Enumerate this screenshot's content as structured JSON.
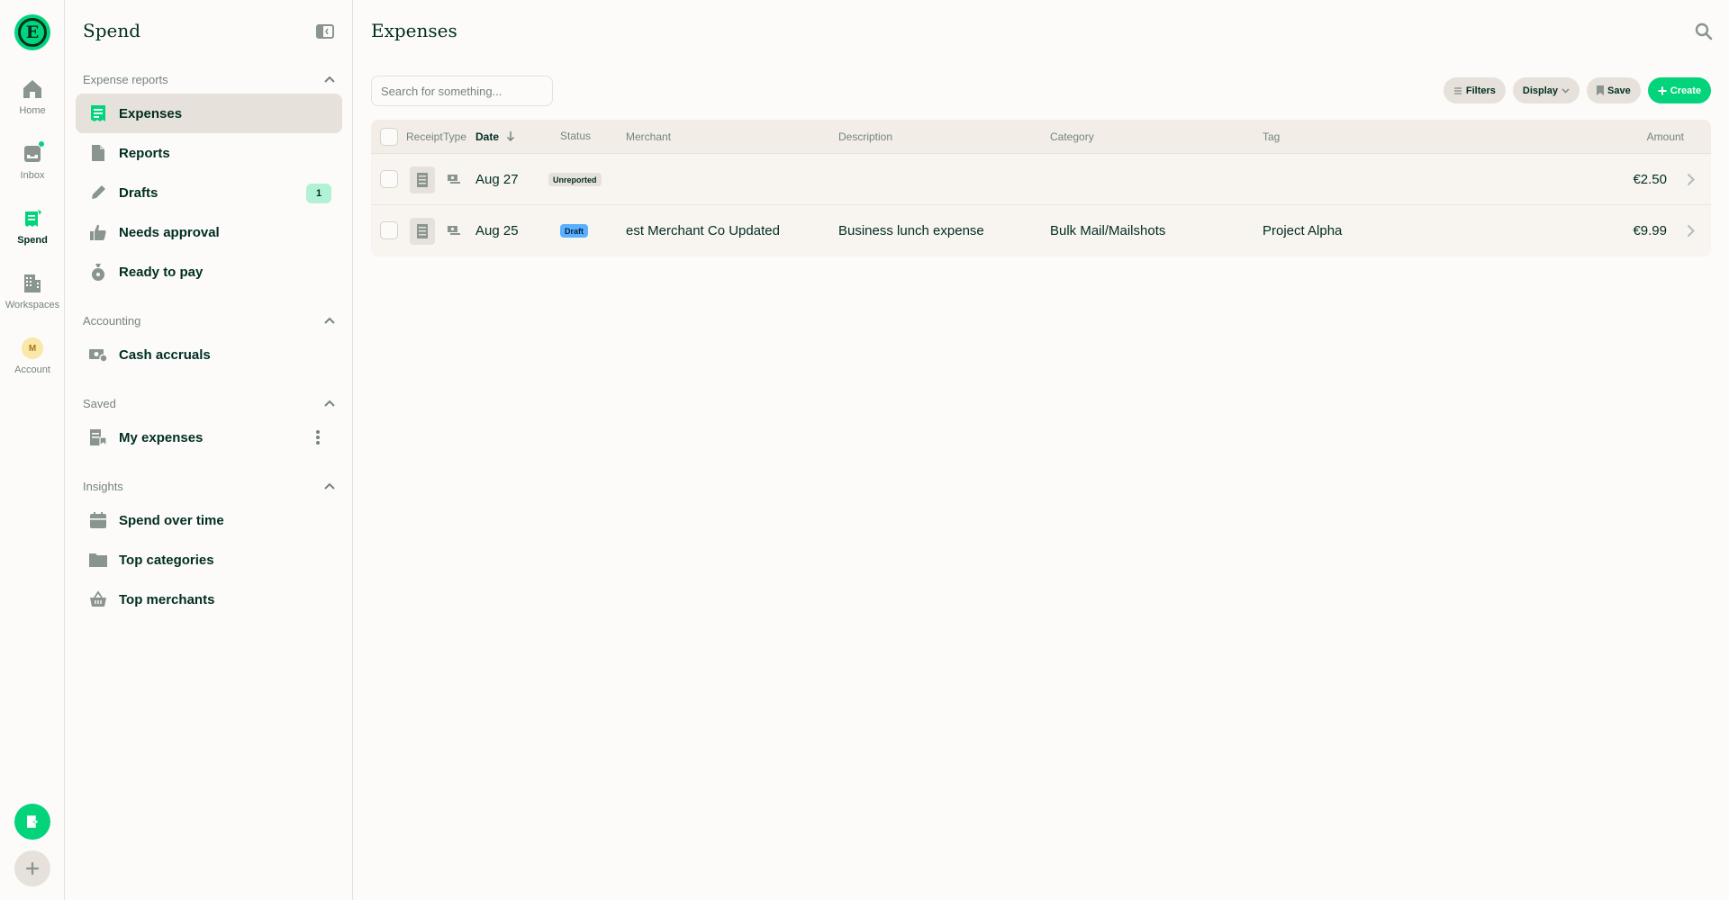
{
  "rail": {
    "logo_letter": "E",
    "items": [
      {
        "label": "Home",
        "icon": "home-icon"
      },
      {
        "label": "Inbox",
        "icon": "inbox-icon"
      },
      {
        "label": "Spend",
        "icon": "receipt-icon"
      },
      {
        "label": "Workspaces",
        "icon": "building-icon"
      },
      {
        "label": "Account",
        "icon": "avatar",
        "avatar_letter": "M"
      }
    ]
  },
  "sidebar": {
    "title": "Spend",
    "sections": [
      {
        "label": "Expense reports",
        "items": [
          {
            "label": "Expenses",
            "icon": "receipt-icon"
          },
          {
            "label": "Reports",
            "icon": "document-icon"
          },
          {
            "label": "Drafts",
            "icon": "pencil-icon",
            "badge": "1"
          },
          {
            "label": "Needs approval",
            "icon": "thumbs-up-icon"
          },
          {
            "label": "Ready to pay",
            "icon": "money-bag-icon"
          }
        ]
      },
      {
        "label": "Accounting",
        "items": [
          {
            "label": "Cash accruals",
            "icon": "cash-icon"
          }
        ]
      },
      {
        "label": "Saved",
        "items": [
          {
            "label": "My expenses",
            "icon": "saved-receipt-icon"
          }
        ]
      },
      {
        "label": "Insights",
        "items": [
          {
            "label": "Spend over time",
            "icon": "calendar-icon"
          },
          {
            "label": "Top categories",
            "icon": "folder-icon"
          },
          {
            "label": "Top merchants",
            "icon": "basket-icon"
          }
        ]
      }
    ]
  },
  "main": {
    "title": "Expenses",
    "search_placeholder": "Search for something...",
    "toolbar": {
      "filters": "Filters",
      "display": "Display",
      "save": "Save",
      "create": "Create"
    },
    "columns": [
      "Receipt",
      "Type",
      "Date",
      "Status",
      "Merchant",
      "Description",
      "Category",
      "Tag",
      "Amount"
    ],
    "rows": [
      {
        "date": "Aug 27",
        "status": "Unreported",
        "merchant": "",
        "description": "",
        "category": "",
        "tag": "",
        "amount": "€2.50"
      },
      {
        "date": "Aug 25",
        "status": "Draft",
        "merchant": "est Merchant Co Updated",
        "description": "Business lunch expense",
        "category": "Bulk Mail/Mailshots",
        "tag": "Project Alpha",
        "amount": "€9.99"
      }
    ]
  },
  "colors": {
    "accent": "#03d47c",
    "text": "#002e22",
    "muted": "#76847e",
    "border": "#e6e1da",
    "draft": "#5ab0ff"
  }
}
